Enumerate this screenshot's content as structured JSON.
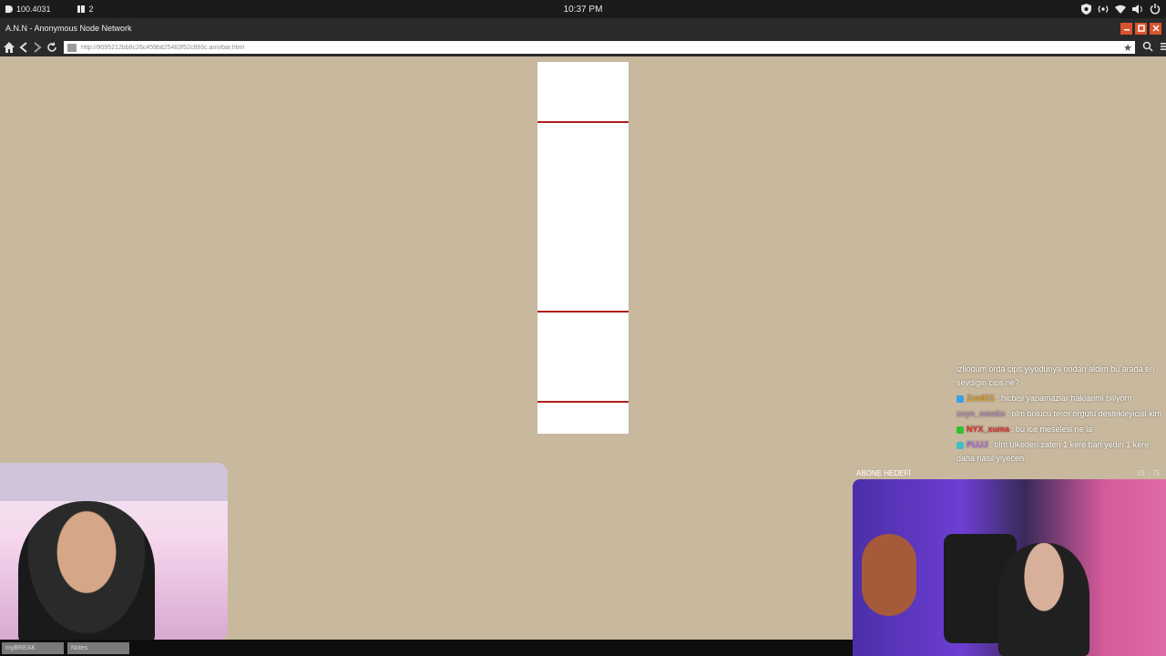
{
  "os_bar": {
    "left_items": [
      {
        "icon": "node-icon",
        "label": "100.4031"
      },
      {
        "icon": "notes-icon",
        "label": "2"
      }
    ],
    "clock": "10:37 PM",
    "right_icons": [
      "shield-icon",
      "signal-icon",
      "wifi-icon",
      "volume-icon",
      "power-icon"
    ]
  },
  "browser": {
    "title": "A.N.N - Anonymous Node Network",
    "url": "http://9095212bb8c26c459bd25463f52c893c.ann/bar.html"
  },
  "page": {
    "bar_color": "#b01d1d",
    "background": "#c7b89e"
  },
  "chat": {
    "messages": [
      {
        "user": "",
        "text": "izliodum orda cips yiyodunya ondan aldim bu arada en sevdigin cips ne?",
        "color": "#ffffff"
      },
      {
        "user": "Zan821",
        "text": ": hicbisi yapamazlar haklarimi biliyom",
        "color": "#e0a030",
        "badge": "#3aa0e0"
      },
      {
        "user": "zeyn_smoke",
        "text": ": olm bolucu teror orgutu destekleyicisi kim",
        "color": "#b08cb0",
        "badge": ""
      },
      {
        "user": "NYX_xuma",
        "text": ": bu ice meselesi ne la",
        "color": "#e03030",
        "badge": "#30c030"
      },
      {
        "user": "PIJJJ",
        "text": ": olm ulkeden zaten 1 kere ban yedin 1 kere daha nasil yiyecen",
        "color": "#b070e0",
        "badge": "#40c0c0"
      }
    ]
  },
  "goal": {
    "label": "ABONE HEDEFİ",
    "counts": "39 ↓ 75"
  },
  "taskbar": {
    "items": [
      "myBREAK",
      "Notes"
    ]
  }
}
